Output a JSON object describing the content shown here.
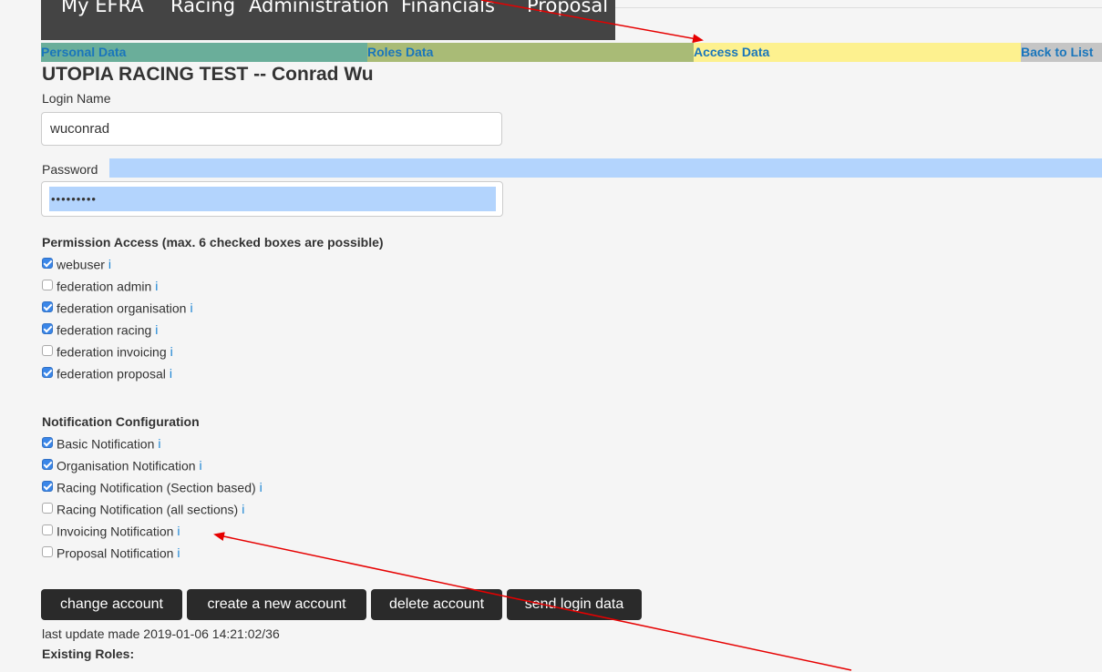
{
  "nav": {
    "items": [
      "My EFRA",
      "Racing",
      "Administration",
      "Financials",
      "Proposal"
    ]
  },
  "tabs": {
    "personal": "Personal Data",
    "roles": "Roles Data",
    "access": "Access Data",
    "back": "Back to List"
  },
  "page_title": "UTOPIA RACING TEST -- Conrad Wu",
  "login": {
    "label": "Login Name",
    "value": "wuconrad"
  },
  "password": {
    "label": "Password",
    "masked": "•••••••••"
  },
  "permissions": {
    "heading": "Permission Access (max. 6 checked boxes are possible)",
    "info_marker": "i",
    "items": [
      {
        "label": "webuser",
        "checked": true
      },
      {
        "label": "federation admin",
        "checked": false
      },
      {
        "label": "federation organisation",
        "checked": true
      },
      {
        "label": "federation racing",
        "checked": true
      },
      {
        "label": "federation invoicing",
        "checked": false
      },
      {
        "label": "federation proposal",
        "checked": true
      }
    ]
  },
  "notifications": {
    "heading": "Notification Configuration",
    "items": [
      {
        "label": "Basic Notification",
        "checked": true
      },
      {
        "label": "Organisation Notification",
        "checked": true
      },
      {
        "label": "Racing Notification (Section based)",
        "checked": true
      },
      {
        "label": "Racing Notification (all sections)",
        "checked": false
      },
      {
        "label": "Invoicing Notification",
        "checked": false
      },
      {
        "label": "Proposal Notification",
        "checked": false
      }
    ]
  },
  "buttons": {
    "change": "change account",
    "create": "create a new account",
    "delete": "delete account",
    "send": "send login data"
  },
  "last_update": "last update made 2019-01-06 14:21:02/36",
  "existing_roles": "Existing Roles:",
  "colors": {
    "nav_bg": "#444444",
    "tab_personal": "#6aae9a",
    "tab_roles": "#a9bb76",
    "tab_access": "#fdf18f",
    "tab_back": "#c5c5c5",
    "link": "#1a76bb",
    "checkbox_on": "#3a86e8",
    "selection": "#b3d4fd",
    "annotation_arrow": "#e60000"
  }
}
